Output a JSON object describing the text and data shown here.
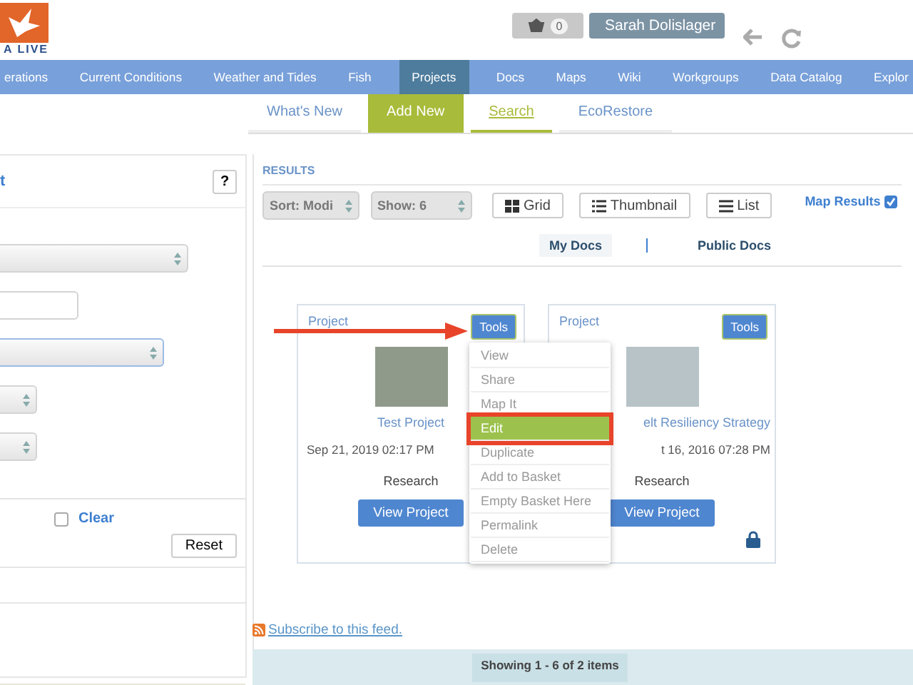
{
  "header": {
    "logo_text": "A LIVE",
    "cart_count": "0",
    "user_name": "Sarah Dolislager"
  },
  "nav": [
    {
      "label": "erations",
      "selected": false
    },
    {
      "label": "Current Conditions",
      "selected": false
    },
    {
      "label": "Weather and Tides",
      "selected": false
    },
    {
      "label": "Fish",
      "selected": false
    },
    {
      "label": "Projects",
      "selected": true
    },
    {
      "label": "Docs",
      "selected": false
    },
    {
      "label": "Maps",
      "selected": false
    },
    {
      "label": "Wiki",
      "selected": false
    },
    {
      "label": "Workgroups",
      "selected": false
    },
    {
      "label": "Data Catalog",
      "selected": false
    },
    {
      "label": "Explor",
      "selected": false
    }
  ],
  "subnav": [
    {
      "label": "What's New",
      "selected": false,
      "highlighted": false
    },
    {
      "label": "Add New",
      "selected": false,
      "highlighted": true
    },
    {
      "label": "Search",
      "selected": true,
      "highlighted": false
    },
    {
      "label": "EcoRestore",
      "selected": false,
      "highlighted": false
    }
  ],
  "filter_panel": {
    "title": "t",
    "help": "?",
    "fields": [
      {
        "kind": "select",
        "focused": false
      },
      {
        "kind": "input",
        "focused": false
      },
      {
        "kind": "select",
        "focused": true
      },
      {
        "kind": "select",
        "focused": false
      },
      {
        "kind": "select",
        "focused": false
      }
    ],
    "clear": {
      "label": "Clear",
      "checked": false
    },
    "reset": "Reset"
  },
  "results": {
    "heading": "RESULTS",
    "sort": "Sort: Modi",
    "show": "Show: 6",
    "views": [
      "Grid",
      "Thumbnail",
      "List"
    ],
    "map_results": {
      "label": "Map Results",
      "checked": true
    },
    "tabs": [
      {
        "label": "My Docs",
        "selected": true
      },
      {
        "label": "Public Docs",
        "selected": false
      }
    ],
    "cards": [
      {
        "type": "Project",
        "tools": "Tools",
        "title": "Test Project",
        "date": "Sep 21, 2019 02:17 PM",
        "category": "Research",
        "action": "View Project",
        "locked": false
      },
      {
        "type": "Project",
        "tools": "Tools",
        "title": "elt Resiliency Strategy",
        "date": "t 16, 2016 07:28 PM",
        "category": "Research",
        "action": "View Project",
        "locked": true
      }
    ],
    "menu": [
      {
        "label": "View",
        "selected": false
      },
      {
        "label": "Share",
        "selected": false
      },
      {
        "label": "Map It",
        "selected": false
      },
      {
        "label": "Edit",
        "selected": true
      },
      {
        "label": "Duplicate",
        "selected": false
      },
      {
        "label": "Add to Basket",
        "selected": false
      },
      {
        "label": "Empty Basket Here",
        "selected": false
      },
      {
        "label": "Permalink",
        "selected": false
      },
      {
        "label": "Delete",
        "selected": false
      }
    ],
    "subscribe": "Subscribe to this feed.",
    "pager": "Showing 1 - 6 of 2 items"
  }
}
